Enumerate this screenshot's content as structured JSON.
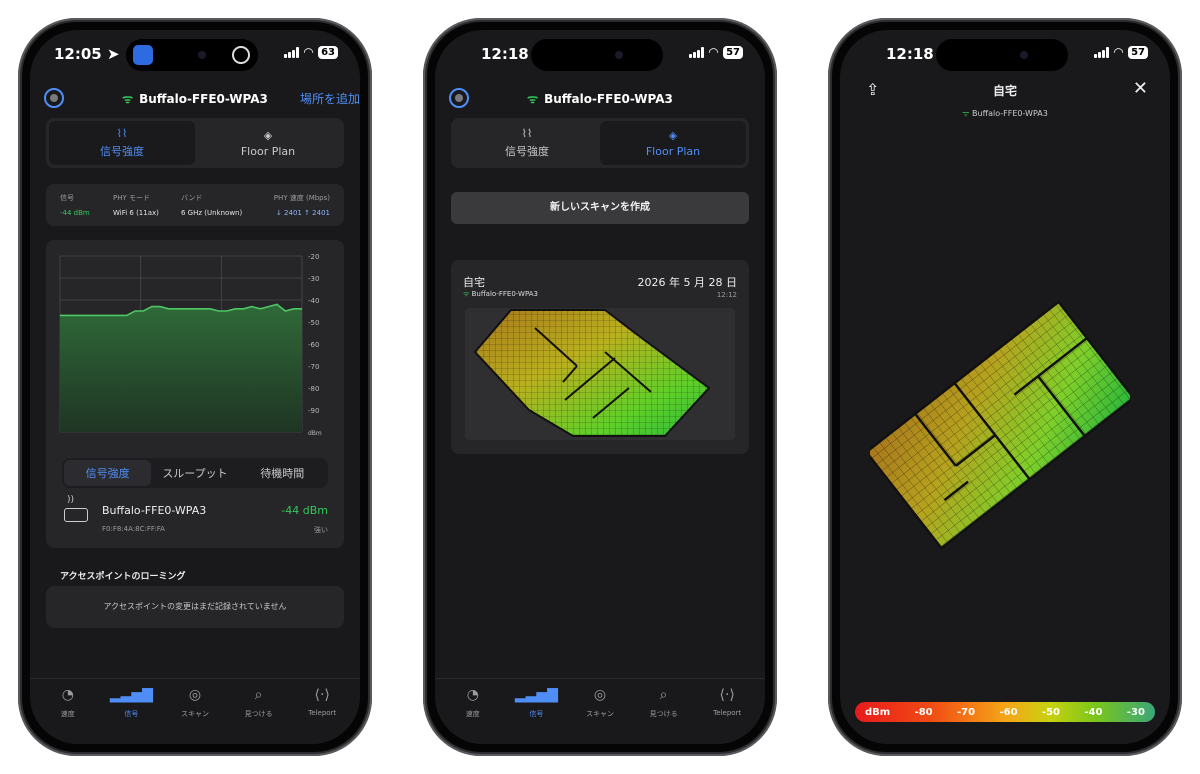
{
  "phone1": {
    "status": {
      "time": "12:05",
      "battery": "63"
    },
    "header": {
      "ssid": "Buffalo-FFE0-WPA3",
      "add_location": "場所を追加"
    },
    "segment": [
      {
        "label": "信号強度",
        "icon": "signal-icon",
        "active": true
      },
      {
        "label": "Floor Plan",
        "icon": "layers-icon",
        "active": false
      }
    ],
    "info": {
      "signal": {
        "label": "信号",
        "value": "-44 dBm"
      },
      "phy_mode": {
        "label": "PHY モード",
        "value": "WiFi 6 (11ax)"
      },
      "band": {
        "label": "バンド",
        "value": "6 GHz (Unknown)"
      },
      "phy_rate": {
        "label": "PHY 速度 (Mbps)",
        "value": "↓ 2401 ↑ 2401"
      }
    },
    "chart_tabs": [
      {
        "label": "信号強度",
        "active": true
      },
      {
        "label": "スループット",
        "active": false
      },
      {
        "label": "待機時間",
        "active": false
      }
    ],
    "access_point": {
      "name": "Buffalo-FFE0-WPA3",
      "mac": "F0:F8:4A:8C:FF:FA",
      "dbm": "-44 dBm",
      "quality": "強い"
    },
    "roaming": {
      "heading": "アクセスポイントのローミング",
      "empty_message": "アクセスポイントの変更はまだ記録されていません"
    }
  },
  "chart_data": {
    "type": "area",
    "title": "",
    "xlabel": "",
    "ylabel": "dBm",
    "ylim": [
      -100,
      -20
    ],
    "y_ticks": [
      "-20",
      "-30",
      "-40",
      "-50",
      "-60",
      "-70",
      "-80",
      "-90"
    ],
    "y_unit_label": "dBm",
    "grid": true,
    "x": [
      0,
      1,
      2,
      3,
      4,
      5,
      6,
      7,
      8,
      9,
      10,
      11,
      12,
      13,
      14,
      15,
      16,
      17,
      18,
      19,
      20,
      21,
      22,
      23,
      24,
      25,
      26,
      27,
      28,
      29
    ],
    "values": [
      -47,
      -47,
      -47,
      -47,
      -47,
      -47,
      -47,
      -47,
      -47,
      -45,
      -45,
      -43,
      -43,
      -44,
      -44,
      -44,
      -44,
      -44,
      -44,
      -45,
      -45,
      -44,
      -44,
      -43,
      -44,
      -43,
      -42,
      -45,
      -44,
      -44
    ],
    "color": "#4cc764"
  },
  "phone2": {
    "status": {
      "time": "12:18",
      "battery": "57"
    },
    "header": {
      "ssid": "Buffalo-FFE0-WPA3"
    },
    "segment": [
      {
        "label": "信号強度",
        "icon": "signal-icon",
        "active": false
      },
      {
        "label": "Floor Plan",
        "icon": "layers-icon",
        "active": true
      }
    ],
    "new_scan": "新しいスキャンを作成",
    "scan_card": {
      "title": "自宅",
      "date": "2026 年 5 月 28 日",
      "ssid": "Buffalo-FFE0-WPA3",
      "time": "12:12"
    }
  },
  "phone3": {
    "status": {
      "time": "12:18",
      "battery": "57"
    },
    "title": "自宅",
    "ssid": "Buffalo-FFE0-WPA3",
    "legend": [
      "dBm",
      "-80",
      "-70",
      "-60",
      "-50",
      "-40",
      "-30"
    ]
  },
  "tabbar": [
    {
      "label": "速度",
      "icon": "gauge-icon"
    },
    {
      "label": "信号",
      "icon": "signal-bars-icon",
      "active": true
    },
    {
      "label": "スキャン",
      "icon": "radar-icon"
    },
    {
      "label": "見つける",
      "icon": "locate-icon"
    },
    {
      "label": "Teleport",
      "icon": "teleport-icon"
    }
  ],
  "colors": {
    "accent": "#4f8ef7",
    "good": "#35c759",
    "bg": "#19191b",
    "card": "#262629"
  }
}
